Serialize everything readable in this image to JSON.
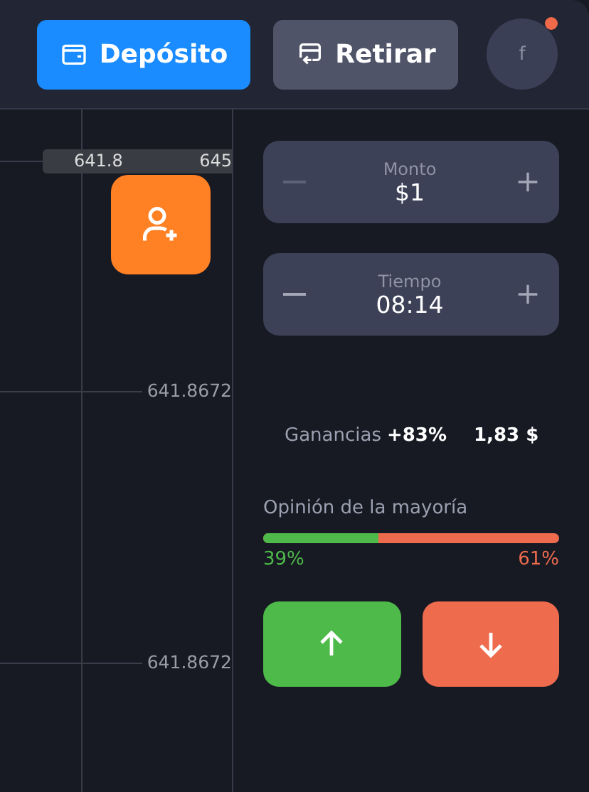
{
  "header": {
    "buttons": [
      {
        "kind": "deposit",
        "label": "Depósito"
      },
      {
        "kind": "withdraw",
        "label": "Retirar"
      }
    ],
    "avatar": {
      "initial": "f",
      "notification": true
    }
  },
  "chart": {
    "price_tag": [
      "641.8",
      "645"
    ],
    "axis_labels": [
      "641.8672",
      "641.8672"
    ]
  },
  "panel": {
    "fields": [
      {
        "label": "Monto",
        "value": "$1",
        "minus_disabled": true
      },
      {
        "label": "Tiempo",
        "value": "08:14",
        "minus_disabled": false
      }
    ],
    "payout": {
      "label": "Ganancias",
      "percent": "+83%",
      "amount": "1,83 $"
    },
    "majority": {
      "label": "Opinión de la mayoría",
      "level": 0.39,
      "up": "39%",
      "down": "61%"
    },
    "trade_buttons": [
      {
        "kind": "up"
      },
      {
        "kind": "down"
      }
    ]
  }
}
